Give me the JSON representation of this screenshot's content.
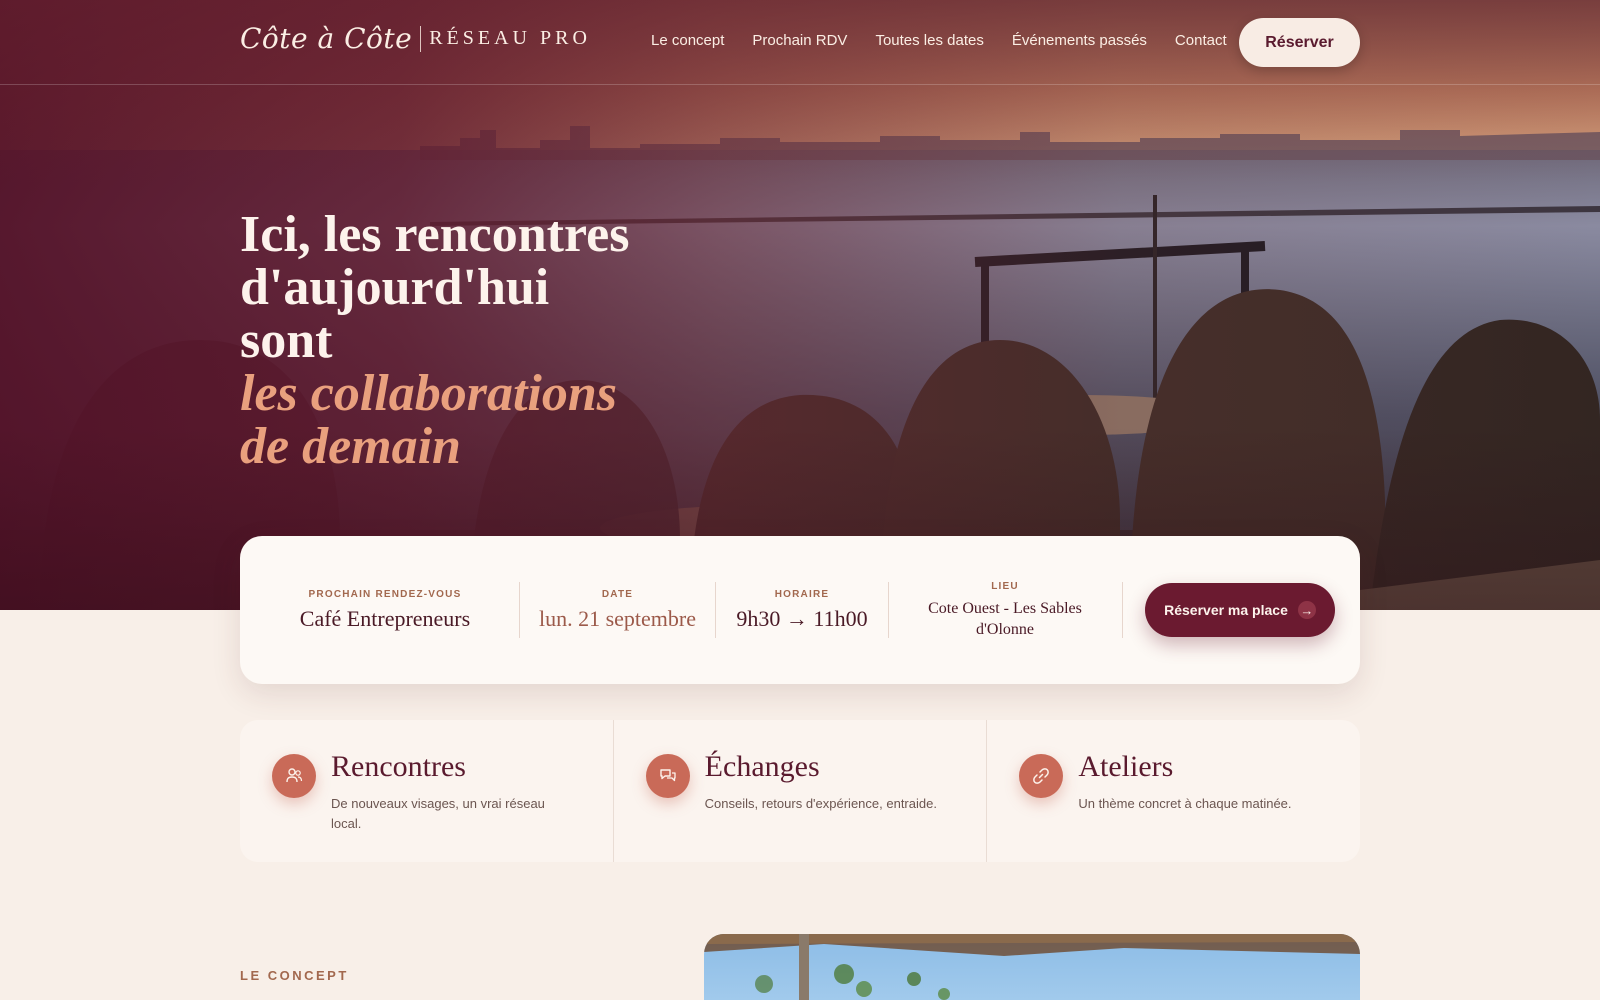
{
  "brand": {
    "script": "Côte à Côte",
    "pro": "RÉSEAU PRO"
  },
  "nav": {
    "items": [
      "Le concept",
      "Prochain RDV",
      "Toutes les dates",
      "Événements passés",
      "Contact"
    ],
    "cta": "Réserver"
  },
  "hero": {
    "line1": "Ici, les rencontres",
    "line2": "d'aujourd'hui",
    "line3": "sont",
    "accent1": "les collaborations",
    "accent2": "de demain"
  },
  "next_event": {
    "label_event": "PROCHAIN RENDEZ-VOUS",
    "event": "Café Entrepreneurs",
    "label_date": "DATE",
    "date": "lun. 21 septembre",
    "label_time": "HORAIRE",
    "time": "9h30 → 11h00",
    "label_place": "LIEU",
    "place": "Cote Ouest - Les Sables d'Olonne",
    "cta": "Réserver ma place"
  },
  "features": [
    {
      "icon": "people-icon",
      "title": "Rencontres",
      "desc": "De nouveaux visages, un vrai réseau local."
    },
    {
      "icon": "chat-icon",
      "title": "Échanges",
      "desc": "Conseils, retours d'expérience, entraide."
    },
    {
      "icon": "link-icon",
      "title": "Ateliers",
      "desc": "Un thème concret à chaque matinée."
    }
  ],
  "concept": {
    "label": "LE CONCEPT"
  },
  "colors": {
    "primary": "#6b1a30",
    "accent": "#c96a58",
    "cream": "#f8efe8",
    "headline_accent": "#e9a07e"
  }
}
